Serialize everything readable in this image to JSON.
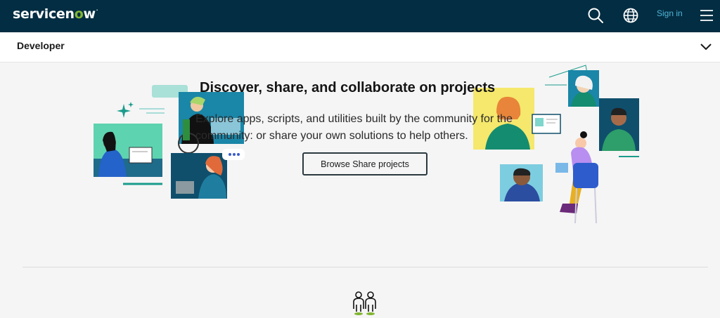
{
  "header": {
    "logo_part1": "servicen",
    "logo_o": "o",
    "logo_part2": "w",
    "logo_tm": ".",
    "signin_label": "Sign in",
    "bg_color": "#032d42",
    "accent_color": "#81b532",
    "link_color": "#4fb6d8"
  },
  "subnav": {
    "title": "Developer"
  },
  "hero": {
    "headline": "Discover, share, and collaborate on projects",
    "subtext": "Explore apps, scripts, and utilities built by the community for the community: or share your own solutions to help others.",
    "cta_label": "Browse Share projects"
  },
  "icons": [
    "search-icon",
    "globe-icon",
    "menu-icon",
    "chevron-down-icon",
    "people-icon"
  ]
}
